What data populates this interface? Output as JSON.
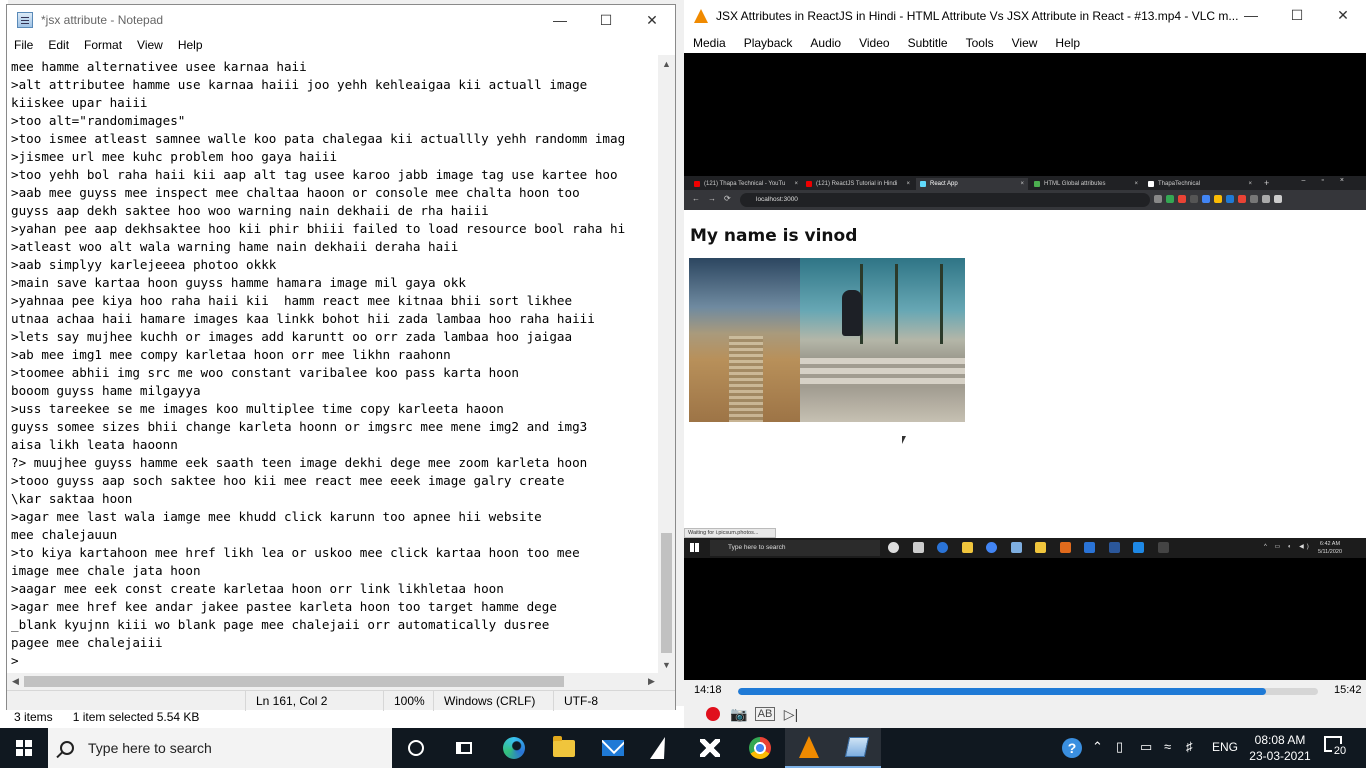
{
  "explorer": {
    "items_count": "3 items",
    "selection": "1 item selected  5.54 KB"
  },
  "notepad": {
    "title": "*jsx attribute - Notepad",
    "menu": [
      "File",
      "Edit",
      "Format",
      "View",
      "Help"
    ],
    "lines": [
      "mee hamme alternativee usee karnaa haii",
      ">alt attributee hamme use karnaa haiii joo yehh kehleaigaa kii actuall image",
      "kiiskee upar haiii",
      ">too alt=\"randomimages\"",
      ">too ismee atleast samnee walle koo pata chalegaa kii actuallly yehh randomm imag",
      ">jismee url mee kuhc problem hoo gaya haiii",
      ">too yehh bol raha haii kii aap alt tag usee karoo jabb image tag use kartee hoo",
      ">aab mee guyss mee inspect mee chaltaa haoon or console mee chalta hoon too",
      "guyss aap dekh saktee hoo woo warning nain dekhaii de rha haiii",
      ">yahan pee aap dekhsaktee hoo kii phir bhiii failed to load resource bool raha hi",
      ">atleast woo alt wala warning hame nain dekhaii deraha haii",
      ">aab simplyy karlejeeea photoo okkk",
      ">main save kartaa hoon guyss hamme hamara image mil gaya okk",
      ">yahnaa pee kiya hoo raha haii kii  hamm react mee kitnaa bhii sort likhee",
      "utnaa achaa haii hamare images kaa linkk bohot hii zada lambaa hoo raha haiii",
      ">lets say mujhee kuchh or images add karuntt oo orr zada lambaa hoo jaigaa",
      ">ab mee img1 mee compy karletaa hoon orr mee likhn raahonn",
      ">toomee abhii img src me woo constant varibalee koo pass karta hoon",
      "booom guyss hame milgayya",
      ">uss tareekee se me images koo multiplee time copy karleeta haoon",
      "guyss somee sizes bhii change karleta hoonn or imgsrc mee mene img2 and img3",
      "aisa likh leata haoonn",
      "?> muujhee guyss hamme eek saath teen image dekhi dege mee zoom karleta hoon",
      ">tooo guyss aap soch saktee hoo kii mee react mee eeek image galry create",
      "\\kar saktaa hoon",
      ">agar mee last wala iamge mee khudd click karunn too apnee hii website",
      "mee chalejauun",
      ">to kiya kartahoon mee href likh lea or uskoo mee click kartaa hoon too mee",
      "image mee chale jata hoon",
      ">aagar mee eek const create karletaa hoon orr link likhletaa hoon",
      ">agar mee href kee andar jakee pastee karleta hoon too target hamme dege",
      "_blank kyujnn kiii wo blank page mee chalejaii orr automatically dusree",
      "pagee mee chalejaiii",
      ">"
    ],
    "status": {
      "position": "Ln 161, Col 2",
      "zoom": "100%",
      "line_ending": "Windows (CRLF)",
      "encoding": "UTF-8"
    }
  },
  "vlc": {
    "title": "JSX Attributes in ReactJS in Hindi - HTML Attribute Vs JSX Attribute in React  - #13.mp4 - VLC m...",
    "menu": [
      "Media",
      "Playback",
      "Audio",
      "Video",
      "Subtitle",
      "Tools",
      "View",
      "Help"
    ],
    "elapsed": "14:18",
    "total": "15:42",
    "progress_fraction": 0.91,
    "video": {
      "tabs": [
        "(121) Thapa Technical - YouTu",
        "(121) ReactJS Tutorial in Hindi",
        "React App",
        "HTML Global attributes",
        "ThapaTechnical"
      ],
      "url": "localhost:3000",
      "heading": "My name is vinod",
      "loading_status": "Waiting for i.picsum.photos...",
      "taskbar_search": "Type here to search",
      "clock_time": "6:42 AM",
      "clock_date": "5/11/2020"
    }
  },
  "taskbar": {
    "search_placeholder": "Type here to search",
    "language": "ENG",
    "time": "08:08 AM",
    "date": "23-03-2021",
    "notification_count": "20"
  },
  "colors": {
    "taskbar_bg": "#101820",
    "vlc_seek": "#1f7ad6",
    "vlc_record": "#e0101c"
  }
}
